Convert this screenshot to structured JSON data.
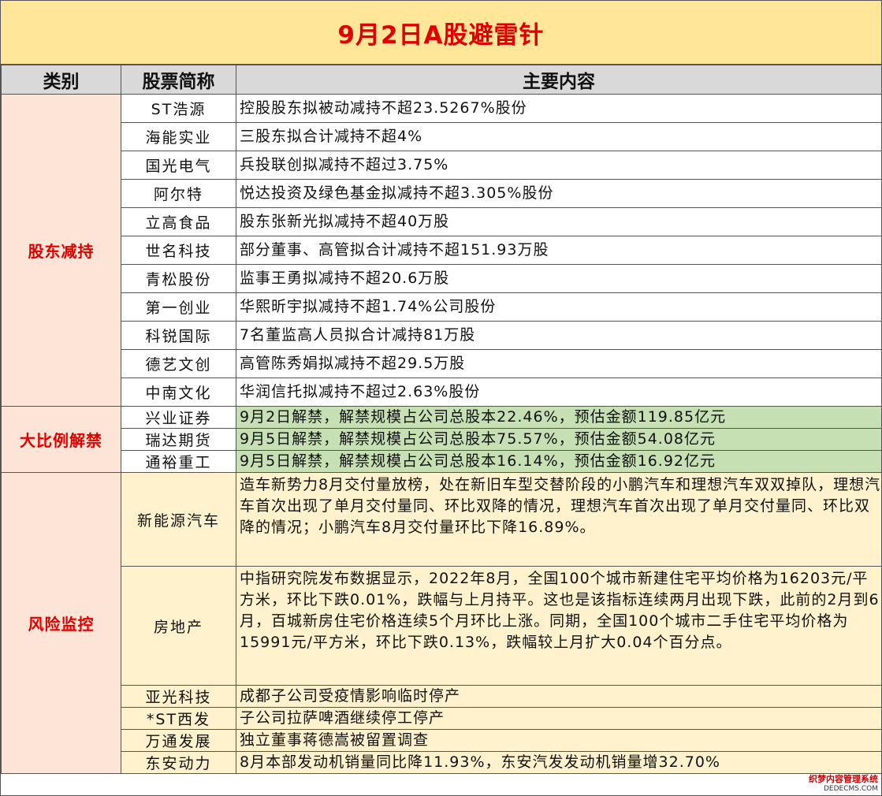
{
  "title": "9月2日A股避雷针",
  "headers": {
    "category": "类别",
    "stock": "股票简称",
    "content": "主要内容"
  },
  "groups": [
    {
      "category": "股东减持",
      "rows": [
        {
          "name": "ST浩源",
          "content": "控股股东拟被动减持不超23.5267%股份"
        },
        {
          "name": "海能实业",
          "content": "三股东拟合计减持不超4%"
        },
        {
          "name": "国光电气",
          "content": "兵投联创拟减持不超过3.75%"
        },
        {
          "name": "阿尔特",
          "content": "悦达投资及绿色基金拟减持不超3.305%股份"
        },
        {
          "name": "立高食品",
          "content": "股东张新光拟减持不超40万股"
        },
        {
          "name": "世名科技",
          "content": "部分董事、高管拟合计减持不超151.93万股"
        },
        {
          "name": "青松股份",
          "content": "监事王勇拟减持不超20.6万股"
        },
        {
          "name": "第一创业",
          "content": "华熙昕宇拟减持不超1.74%公司股份"
        },
        {
          "name": "科锐国际",
          "content": "7名董监高人员拟合计减持81万股"
        },
        {
          "name": "德艺文创",
          "content": "高管陈秀娟拟减持不超29.5万股"
        },
        {
          "name": "中南文化",
          "content": "华润信托拟减持不超过2.63%股份"
        }
      ]
    },
    {
      "category": "大比例解禁",
      "rows": [
        {
          "name": "兴业证券",
          "content": "9月2日解禁，解禁规模占公司总股本22.46%，预估金额119.85亿元"
        },
        {
          "name": "瑞达期货",
          "content": "9月5日解禁，解禁规模占公司总股本75.57%，预估金额54.08亿元"
        },
        {
          "name": "通裕重工",
          "content": "9月5日解禁，解禁规模占公司总股本16.14%，预估金额16.92亿元"
        }
      ]
    },
    {
      "category": "风险监控",
      "rows": [
        {
          "name": "新能源汽车",
          "content": "造车新势力8月交付量放榜，处在新旧车型交替阶段的小鹏汽车和理想汽车双双掉队，理想汽车首次出现了单月交付量同、环比双降的情况，理想汽车首次出现了单月交付量同、环比双降的情况；小鹏汽车8月交付量环比下降16.89%。"
        },
        {
          "name": "房地产",
          "content": "中指研究院发布数据显示，2022年8月，全国100个城市新建住宅平均价格为16203元/平方米，环比下跌0.01%，跌幅与上月持平。这也是该指标连续两月出现下跌，此前的2月到6月，百城新房住宅价格连续5个月环比上涨。同期，全国100个城市二手住宅平均价格为15991元/平方米，环比下跌0.13%，跌幅较上月扩大0.04个百分点。"
        },
        {
          "name": "亚光科技",
          "content": "成都子公司受疫情影响临时停产"
        },
        {
          "name": "*ST西发",
          "content": "子公司拉萨啤酒继续停工停产"
        },
        {
          "name": "万通发展",
          "content": "独立董事蒋德嵩被留置调查"
        },
        {
          "name": "东安动力",
          "content": "8月本部发动机销量同比降11.93%，东安汽发发动机销量增32.70%"
        }
      ]
    }
  ],
  "watermark": {
    "line1": "织梦内容管理系统",
    "line2": "DEDECMS.COM"
  },
  "colors": {
    "title_bg": "#ffe699",
    "title_text": "#e00000",
    "header_bg": "#d9d9d9",
    "category_bg": "#fce4d6",
    "unlock_bg": "#c6e0b4",
    "risk_bg": "#fff2cc"
  }
}
